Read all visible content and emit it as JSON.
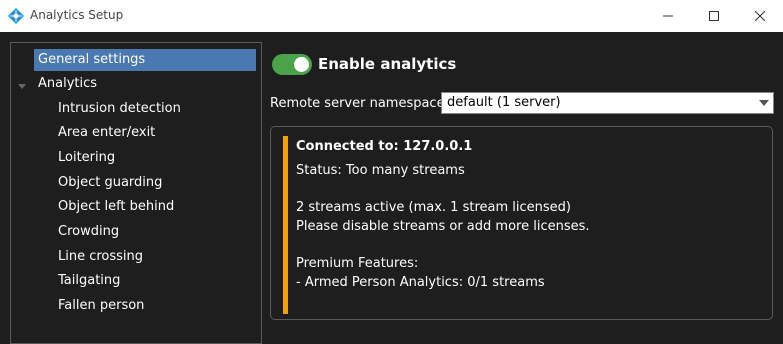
{
  "window": {
    "title": "Analytics Setup",
    "icon": "app-logo-icon"
  },
  "tree": {
    "items": [
      {
        "label": "General settings",
        "level": 1,
        "selected": true
      },
      {
        "label": "Analytics",
        "level": 1,
        "expanded": true
      },
      {
        "label": "Intrusion detection",
        "level": 2
      },
      {
        "label": "Area enter/exit",
        "level": 2
      },
      {
        "label": "Loitering",
        "level": 2
      },
      {
        "label": "Object guarding",
        "level": 2
      },
      {
        "label": "Object left behind",
        "level": 2
      },
      {
        "label": "Crowding",
        "level": 2
      },
      {
        "label": "Line crossing",
        "level": 2
      },
      {
        "label": "Tailgating",
        "level": 2
      },
      {
        "label": "Fallen person",
        "level": 2
      }
    ]
  },
  "settings": {
    "enable_analytics_label": "Enable analytics",
    "enable_analytics_on": true,
    "namespace_label": "Remote server namespace",
    "namespace_value": "default (1 server)"
  },
  "status": {
    "connected": "Connected to: 127.0.0.1",
    "status": "Status: Too many streams",
    "streams": "2 streams active (max. 1 stream licensed)",
    "advice": "Please disable streams or add more licenses.",
    "premium_header": "Premium Features:",
    "premium_item": "- Armed Person Analytics: 0/1 streams"
  },
  "colors": {
    "accent_selected": "#4a78b0",
    "toggle_on": "#4aa34a",
    "warning": "#f5a100"
  }
}
